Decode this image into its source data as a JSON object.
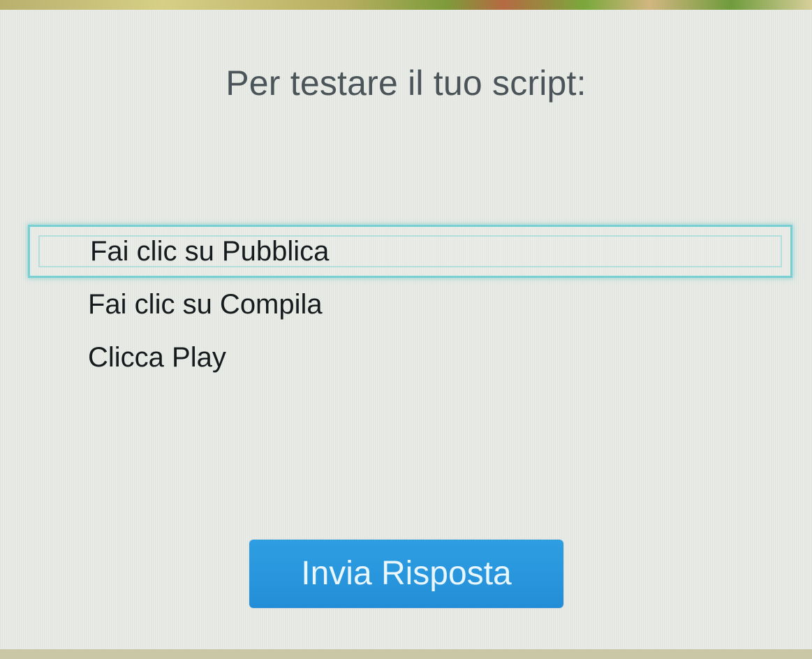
{
  "dialog": {
    "title": "Per testare il tuo script:"
  },
  "options": [
    {
      "label": "Fai clic su Pubblica",
      "selected": true
    },
    {
      "label": "Fai clic su Compila",
      "selected": false
    },
    {
      "label": "Clicca Play",
      "selected": false
    }
  ],
  "actions": {
    "submit_label": "Invia Risposta"
  },
  "colors": {
    "selection_border": "#79cfd1",
    "button_background": "#238ed7",
    "dialog_background": "#e9ece7"
  }
}
